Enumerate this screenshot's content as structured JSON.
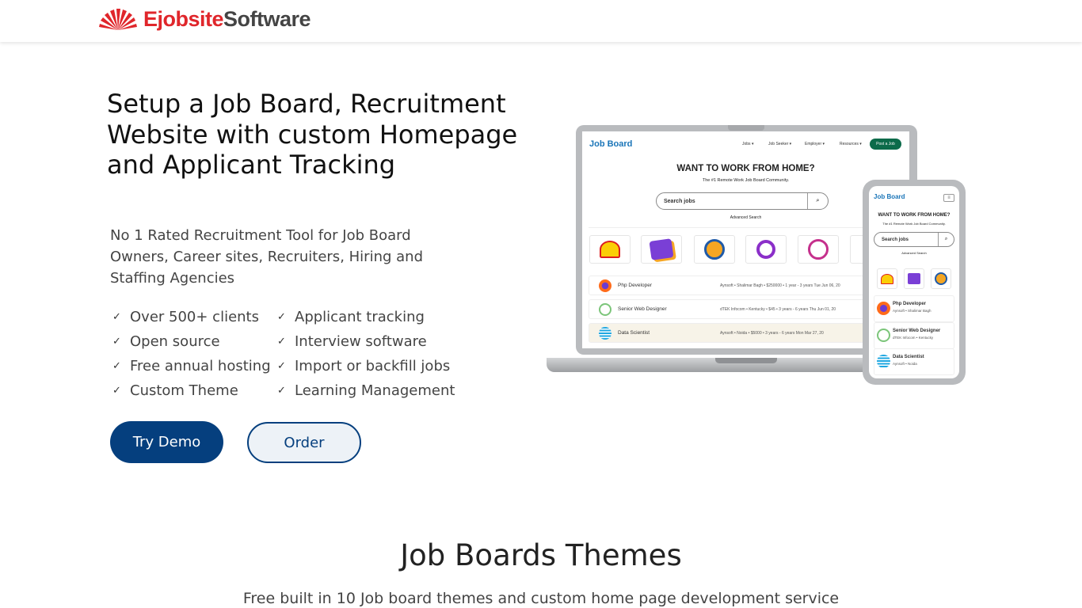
{
  "brand": {
    "part1": "Ejobsite",
    "part2": "Software",
    "color_primary": "#e0262b",
    "color_secondary": "#444444"
  },
  "hero": {
    "title": "Setup a Job Board, Recruitment Website with custom Homepage and Applicant Tracking",
    "lead": "No 1 Rated Recruitment Tool for Job Board Owners, Career sites, Recruiters, Hiring and Staffing Agencies",
    "features_left": [
      "Over 500+ clients",
      "Open source",
      "Free annual hosting",
      "Custom Theme"
    ],
    "features_right": [
      "Applicant tracking",
      "Interview software",
      "Import or backfill jobs",
      "Learning Management"
    ],
    "check_icon": "✓",
    "try_demo": "Try Demo",
    "order": "Order",
    "accent": "#053f7e"
  },
  "mockup": {
    "brand": "Job Board",
    "nav": [
      "Jobs ▾",
      "Job Seeker ▾",
      "Employer ▾",
      "Resources ▾"
    ],
    "post_job": "Post a Job",
    "headline": "WANT TO WORK FROM HOME?",
    "subheadline": "The #1 Remote Work Job Board Community.",
    "search_placeholder": "Search jobs",
    "advanced": "Advanced Search",
    "jobs": [
      {
        "title": "Php Developer",
        "meta": "Aynsoft  • Shalimar Bagh   • $250000   • 1 year - 3 years   Tue Jun 06, 20",
        "short": "Aynsoft  • Shalimar Bagh"
      },
      {
        "title": "Senior Web Designer",
        "meta": "dTEK Infocom  • Kentucky   • $45   • 3 years - 6 years   Thu Jun 01, 20",
        "short": "dTEK Infocom  • Kentucky"
      },
      {
        "title": "Data Scientist",
        "meta": "Aynsoft  • Noida   • $5000   • 3 years - 6 years   Mon Mar 27, 20",
        "short": "Aynsoft  • Noida"
      }
    ]
  },
  "themes": {
    "title": "Job Boards Themes",
    "subtitle": "Free built in 10 Job board themes and custom home page development service"
  }
}
